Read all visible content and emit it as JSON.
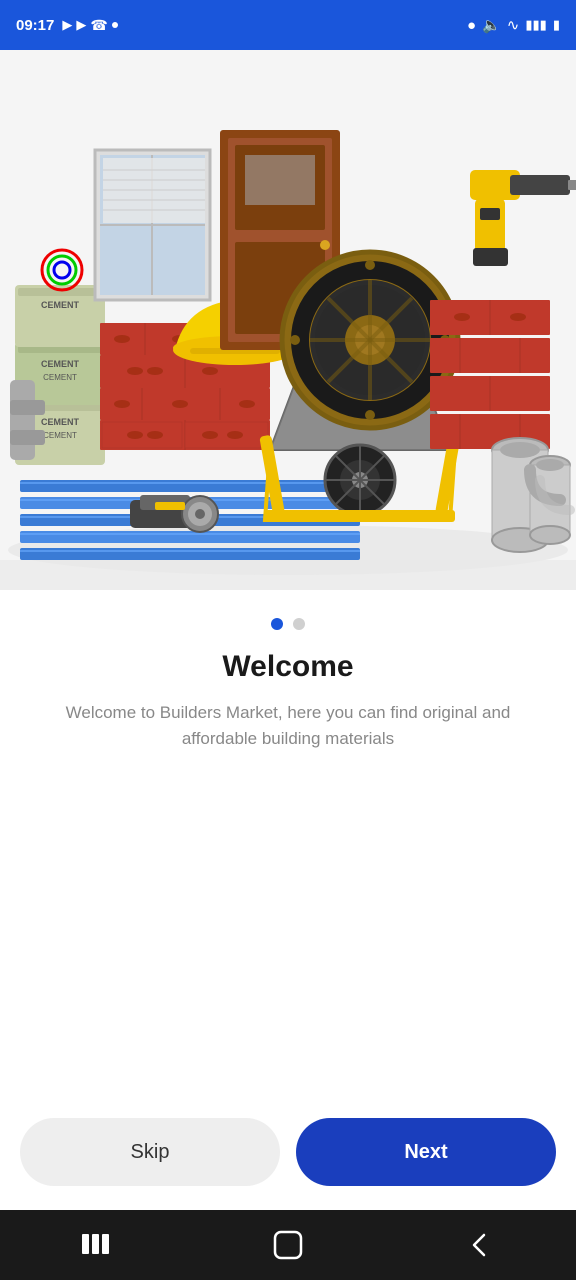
{
  "statusBar": {
    "time": "09:17",
    "dot": "•"
  },
  "image": {
    "altText": "Construction materials including bricks, cement bags, doors, tools, wheelbarrow, cable reel"
  },
  "dots": {
    "active": 0,
    "total": 2
  },
  "content": {
    "title": "Welcome",
    "description": "Welcome to Builders Market, here you can find original and affordable building materials"
  },
  "buttons": {
    "skip": "Skip",
    "next": "Next"
  }
}
